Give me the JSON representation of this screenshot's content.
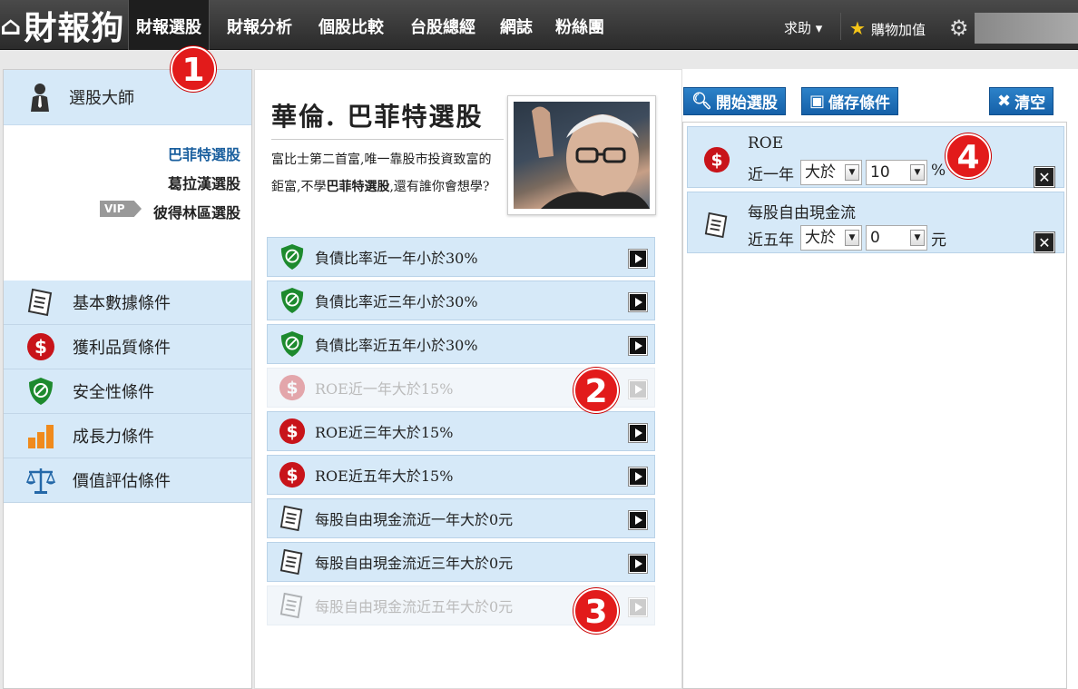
{
  "header": {
    "logo_mark": "⌂",
    "logo_text": "財報狗",
    "nav": [
      "財報選股",
      "財報分析",
      "個股比較",
      "台股總經",
      "網誌",
      "粉絲團"
    ],
    "help": "求助 ▾",
    "shop": "購物加值"
  },
  "badges": [
    "1",
    "2",
    "3",
    "4"
  ],
  "left": {
    "master_title": "選股大師",
    "sub_links": [
      "巴菲特選股",
      "葛拉漢選股",
      "彼得林區選股"
    ],
    "vip": "VIP",
    "categories": [
      "基本數據條件",
      "獲利品質條件",
      "安全性條件",
      "成長力條件",
      "價值評估條件"
    ]
  },
  "mid": {
    "title": "華倫. 巴菲特選股",
    "desc_1": "富比士第二首富,唯一靠股市投資致富的鉅富,不學",
    "desc_bold": "巴菲特選股",
    "desc_2": ",還有誰你會想學?",
    "rules": [
      {
        "label": "負債比率近一年小於30%",
        "icon": "shield-icon",
        "disabled": false
      },
      {
        "label": "負債比率近三年小於30%",
        "icon": "shield-icon",
        "disabled": false
      },
      {
        "label": "負債比率近五年小於30%",
        "icon": "shield-icon",
        "disabled": false
      },
      {
        "label": "ROE近一年大於15%",
        "icon": "dollar-icon",
        "disabled": true
      },
      {
        "label": "ROE近三年大於15%",
        "icon": "dollar-icon",
        "disabled": false
      },
      {
        "label": "ROE近五年大於15%",
        "icon": "dollar-icon",
        "disabled": false
      },
      {
        "label": "每股自由現金流近一年大於0元",
        "icon": "document-icon",
        "disabled": false
      },
      {
        "label": "每股自由現金流近三年大於0元",
        "icon": "document-icon",
        "disabled": false
      },
      {
        "label": "每股自由現金流近五年大於0元",
        "icon": "document-icon",
        "disabled": true
      }
    ]
  },
  "right": {
    "start_btn": "開始選股",
    "save_btn": "儲存條件",
    "clear_btn": "清空",
    "conditions": [
      {
        "name": "ROE",
        "period": "近一年",
        "op": "大於",
        "value": "10",
        "unit": "%"
      },
      {
        "name": "每股自由現金流",
        "period": "近五年",
        "op": "大於",
        "value": "0",
        "unit": "元"
      }
    ]
  },
  "colors": {
    "accent": "#1560a8",
    "badge": "#e21b1b",
    "row_bg": "#d6e9f8"
  }
}
